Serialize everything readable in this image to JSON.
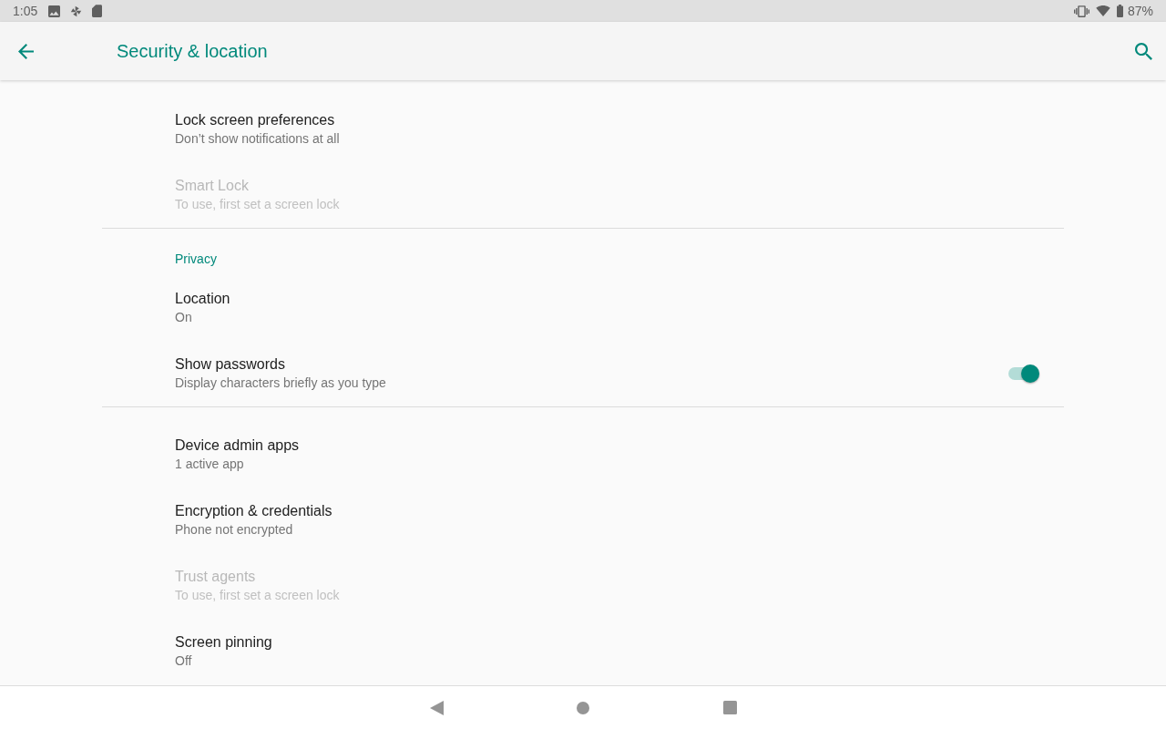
{
  "status_bar": {
    "time": "1:05",
    "battery": "87%"
  },
  "app_bar": {
    "title": "Security & location"
  },
  "sections": [
    {
      "items": [
        {
          "kind": "text",
          "title": "Lock screen preferences",
          "summary": "Don’t show notifications at all",
          "disabled": false
        },
        {
          "kind": "text",
          "title": "Smart Lock",
          "summary": "To use, first set a screen lock",
          "disabled": true
        }
      ]
    },
    {
      "header": "Privacy",
      "items": [
        {
          "kind": "text",
          "title": "Location",
          "summary": "On",
          "disabled": false
        },
        {
          "kind": "switch",
          "title": "Show passwords",
          "summary": "Display characters briefly as you type",
          "disabled": false,
          "on": true
        }
      ]
    },
    {
      "items": [
        {
          "kind": "text",
          "title": "Device admin apps",
          "summary": "1 active app",
          "disabled": false
        },
        {
          "kind": "text",
          "title": "Encryption & credentials",
          "summary": "Phone not encrypted",
          "disabled": false
        },
        {
          "kind": "text",
          "title": "Trust agents",
          "summary": "To use, first set a screen lock",
          "disabled": true
        },
        {
          "kind": "text",
          "title": "Screen pinning",
          "summary": "Off",
          "disabled": false
        }
      ]
    }
  ]
}
